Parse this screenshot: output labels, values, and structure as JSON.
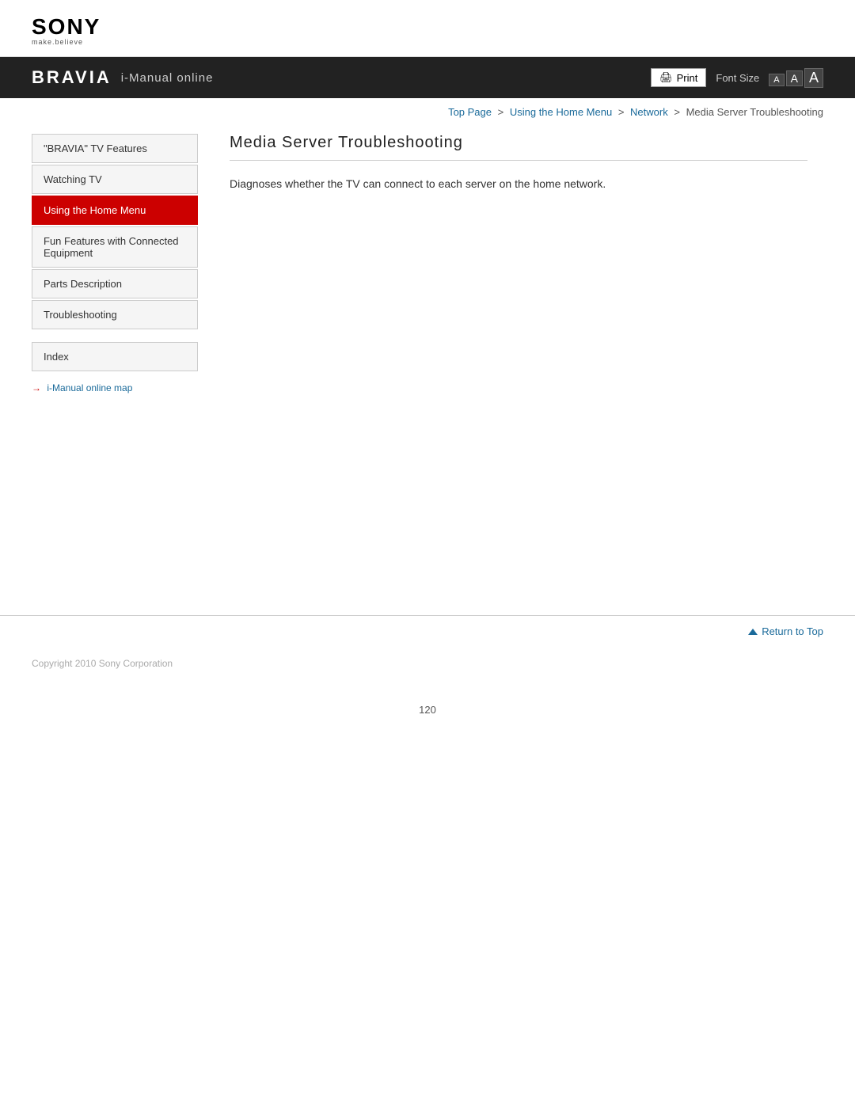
{
  "logo": {
    "brand": "SONY",
    "tagline": "make.believe"
  },
  "header": {
    "bravia": "BRAVIA",
    "imanual": "i-Manual online",
    "print_label": "Print",
    "font_size_label": "Font Size",
    "font_small": "A",
    "font_medium": "A",
    "font_large": "A"
  },
  "breadcrumb": {
    "top_page": "Top Page",
    "sep1": ">",
    "home_menu": "Using the Home Menu",
    "sep2": ">",
    "network": "Network",
    "sep3": ">",
    "current": "Media Server Troubleshooting"
  },
  "sidebar": {
    "items": [
      {
        "label": "\"BRAVIA\" TV Features",
        "active": false
      },
      {
        "label": "Watching TV",
        "active": false
      },
      {
        "label": "Using the Home Menu",
        "active": true
      },
      {
        "label": "Fun Features with Connected Equipment",
        "active": false
      },
      {
        "label": "Parts Description",
        "active": false
      },
      {
        "label": "Troubleshooting",
        "active": false
      }
    ],
    "index_label": "Index",
    "imanual_map_label": "i-Manual online map"
  },
  "content": {
    "title": "Media Server Troubleshooting",
    "body": "Diagnoses whether the TV can connect to each server on the home network."
  },
  "return_top": {
    "label": "Return to Top"
  },
  "footer": {
    "copyright": "Copyright 2010 Sony Corporation"
  },
  "page_number": "120"
}
